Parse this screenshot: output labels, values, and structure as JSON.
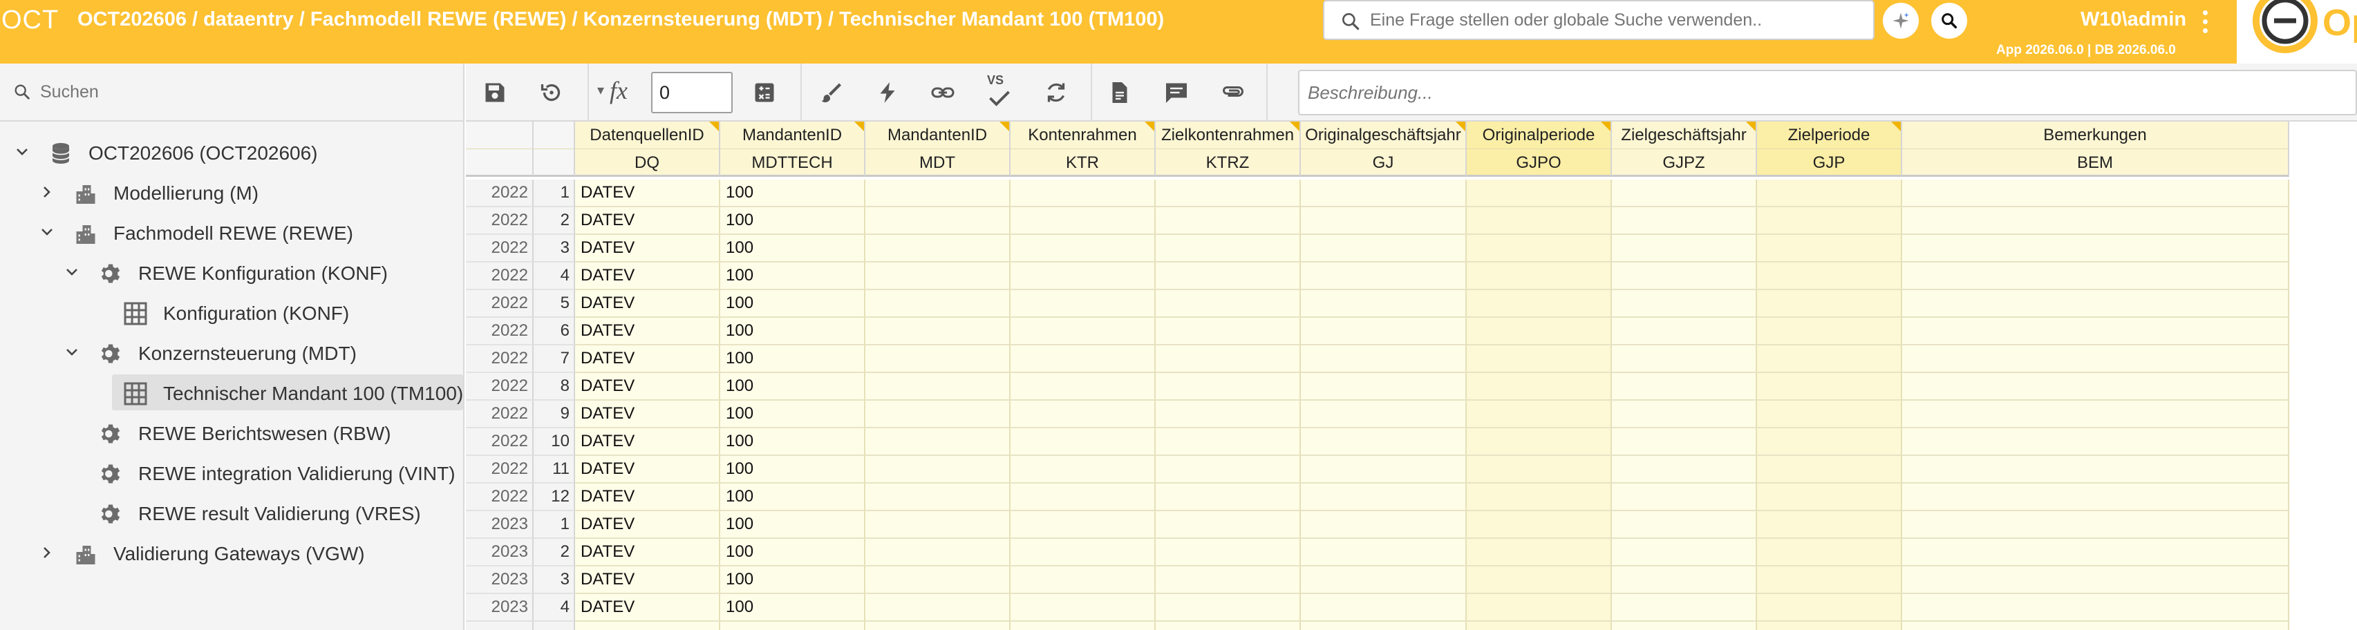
{
  "header": {
    "app_name": "OCT",
    "breadcrumb": "OCT202606 / dataentry / Fachmodell REWE (REWE) / Konzernsteuerung (MDT) / Technischer Mandant 100 (TM100)",
    "search_placeholder": "Eine Frage stellen oder globale Suche verwenden..",
    "user": "W10\\admin",
    "version": "App 2026.06.0 | DB 2026.06.0",
    "logo_text": "Op",
    "accent_color": "#fdc131"
  },
  "sidebar": {
    "search_placeholder": "Suchen",
    "tree": [
      {
        "label": "OCT202606 (OCT202606)",
        "level": 0,
        "icon": "database-icon",
        "expand": "expanded"
      },
      {
        "label": "Modellierung (M)",
        "level": 1,
        "icon": "building-icon",
        "expand": "collapsed"
      },
      {
        "label": "Fachmodell REWE (REWE)",
        "level": 1,
        "icon": "building-icon",
        "expand": "expanded"
      },
      {
        "label": "REWE Konfiguration (KONF)",
        "level": 2,
        "icon": "gear-icon",
        "expand": "expanded"
      },
      {
        "label": "Konfiguration (KONF)",
        "level": 3,
        "icon": "table-icon",
        "expand": "none"
      },
      {
        "label": "Konzernsteuerung (MDT)",
        "level": 2,
        "icon": "gear-icon",
        "expand": "expanded"
      },
      {
        "label": "Technischer Mandant 100 (TM100)",
        "level": 3,
        "icon": "table-icon",
        "expand": "none",
        "selected": true
      },
      {
        "label": "REWE Berichtswesen (RBW)",
        "level": 2,
        "icon": "gear-icon",
        "expand": "none"
      },
      {
        "label": "REWE integration Validierung (VINT)",
        "level": 2,
        "icon": "gear-icon",
        "expand": "none"
      },
      {
        "label": "REWE result Validierung (VRES)",
        "level": 2,
        "icon": "gear-icon",
        "expand": "none"
      },
      {
        "label": "Validierung Gateways (VGW)",
        "level": 1,
        "icon": "building-icon",
        "expand": "collapsed"
      }
    ]
  },
  "toolbar": {
    "formula_label": "fx",
    "value_input": "0",
    "vs_label": "VS",
    "description_placeholder": "Beschreibung..."
  },
  "grid": {
    "columns": [
      {
        "label": "DatenquellenID",
        "code": "DQ",
        "highlight": false
      },
      {
        "label": "MandantenID",
        "code": "MDTTECH",
        "highlight": false
      },
      {
        "label": "MandantenID",
        "code": "MDT",
        "highlight": false
      },
      {
        "label": "Kontenrahmen",
        "code": "KTR",
        "highlight": false
      },
      {
        "label": "Zielkontenrahmen",
        "code": "KTRZ",
        "highlight": false
      },
      {
        "label": "Originalgeschäftsjahr",
        "code": "GJ",
        "highlight": false
      },
      {
        "label": "Originalperiode",
        "code": "GJPO",
        "highlight": true
      },
      {
        "label": "Zielgeschäftsjahr",
        "code": "GJPZ",
        "highlight": false
      },
      {
        "label": "Zielperiode",
        "code": "GJP",
        "highlight": true
      },
      {
        "label": "Bemerkungen",
        "code": "BEM",
        "highlight": false
      }
    ],
    "rows": [
      {
        "year": "2022",
        "period": "1",
        "values": [
          "DATEV",
          "100",
          "",
          "",
          "",
          "",
          "",
          "",
          "",
          ""
        ]
      },
      {
        "year": "2022",
        "period": "2",
        "values": [
          "DATEV",
          "100",
          "",
          "",
          "",
          "",
          "",
          "",
          "",
          ""
        ]
      },
      {
        "year": "2022",
        "period": "3",
        "values": [
          "DATEV",
          "100",
          "",
          "",
          "",
          "",
          "",
          "",
          "",
          ""
        ]
      },
      {
        "year": "2022",
        "period": "4",
        "values": [
          "DATEV",
          "100",
          "",
          "",
          "",
          "",
          "",
          "",
          "",
          ""
        ]
      },
      {
        "year": "2022",
        "period": "5",
        "values": [
          "DATEV",
          "100",
          "",
          "",
          "",
          "",
          "",
          "",
          "",
          ""
        ]
      },
      {
        "year": "2022",
        "period": "6",
        "values": [
          "DATEV",
          "100",
          "",
          "",
          "",
          "",
          "",
          "",
          "",
          ""
        ]
      },
      {
        "year": "2022",
        "period": "7",
        "values": [
          "DATEV",
          "100",
          "",
          "",
          "",
          "",
          "",
          "",
          "",
          ""
        ]
      },
      {
        "year": "2022",
        "period": "8",
        "values": [
          "DATEV",
          "100",
          "",
          "",
          "",
          "",
          "",
          "",
          "",
          ""
        ]
      },
      {
        "year": "2022",
        "period": "9",
        "values": [
          "DATEV",
          "100",
          "",
          "",
          "",
          "",
          "",
          "",
          "",
          ""
        ]
      },
      {
        "year": "2022",
        "period": "10",
        "values": [
          "DATEV",
          "100",
          "",
          "",
          "",
          "",
          "",
          "",
          "",
          ""
        ]
      },
      {
        "year": "2022",
        "period": "11",
        "values": [
          "DATEV",
          "100",
          "",
          "",
          "",
          "",
          "",
          "",
          "",
          ""
        ]
      },
      {
        "year": "2022",
        "period": "12",
        "values": [
          "DATEV",
          "100",
          "",
          "",
          "",
          "",
          "",
          "",
          "",
          ""
        ]
      },
      {
        "year": "2023",
        "period": "1",
        "values": [
          "DATEV",
          "100",
          "",
          "",
          "",
          "",
          "",
          "",
          "",
          ""
        ]
      },
      {
        "year": "2023",
        "period": "2",
        "values": [
          "DATEV",
          "100",
          "",
          "",
          "",
          "",
          "",
          "",
          "",
          ""
        ]
      },
      {
        "year": "2023",
        "period": "3",
        "values": [
          "DATEV",
          "100",
          "",
          "",
          "",
          "",
          "",
          "",
          "",
          ""
        ]
      },
      {
        "year": "2023",
        "period": "4",
        "values": [
          "DATEV",
          "100",
          "",
          "",
          "",
          "",
          "",
          "",
          "",
          ""
        ]
      },
      {
        "year": "",
        "period": "",
        "values": [
          "",
          "",
          "",
          "",
          "",
          "",
          "",
          "",
          "",
          ""
        ]
      }
    ]
  }
}
